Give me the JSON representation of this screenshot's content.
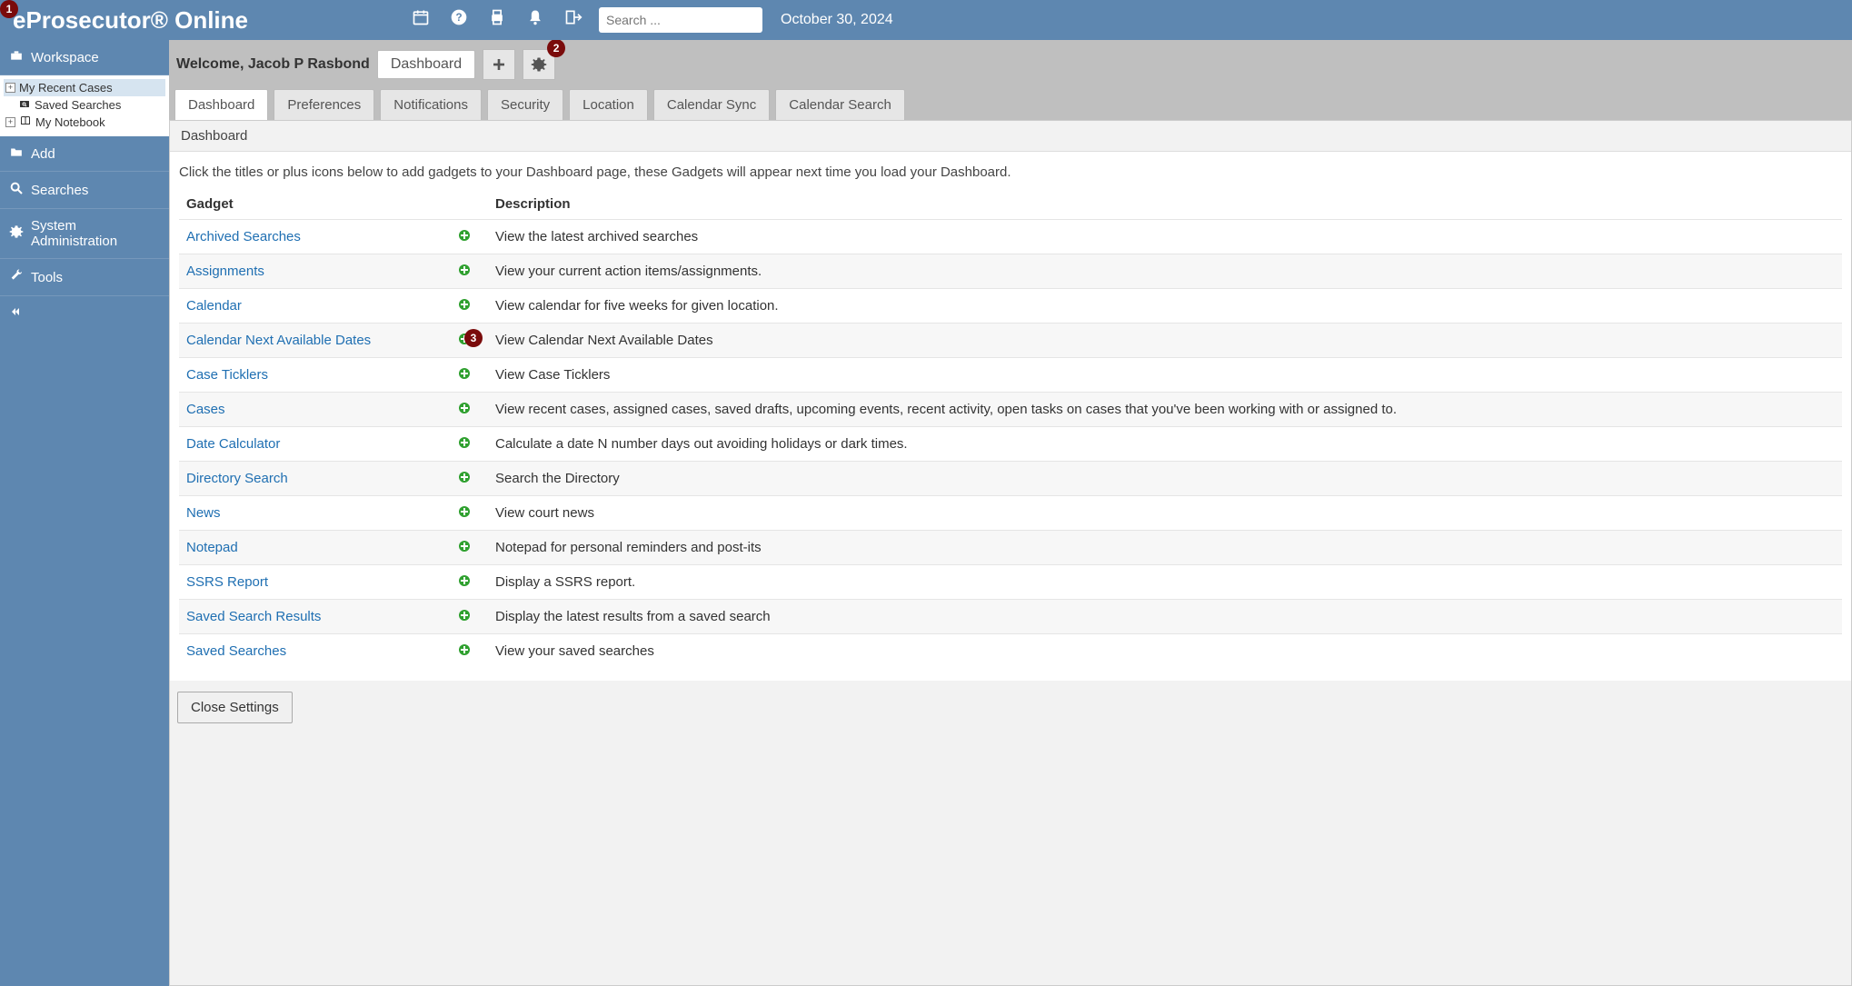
{
  "app_title": "eProsecutor® Online",
  "header": {
    "search_placeholder": "Search ...",
    "date": "October 30, 2024"
  },
  "sidebar": {
    "workspace_label": "Workspace",
    "tree": {
      "recent_cases": "My Recent Cases",
      "saved_searches": "Saved Searches",
      "my_notebook": "My Notebook"
    },
    "add_label": "Add",
    "searches_label": "Searches",
    "sysadmin_label": "System Administration",
    "tools_label": "Tools"
  },
  "welcome": "Welcome, Jacob P Rasbond",
  "dash_tab": "Dashboard",
  "settings_tabs": {
    "dashboard": "Dashboard",
    "preferences": "Preferences",
    "notifications": "Notifications",
    "security": "Security",
    "location": "Location",
    "calendar_sync": "Calendar Sync",
    "calendar_search": "Calendar Search"
  },
  "panel_header": "Dashboard",
  "intro": "Click the titles or plus icons below to add gadgets to your Dashboard page, these Gadgets will appear next time you load your Dashboard.",
  "columns": {
    "gadget": "Gadget",
    "description": "Description"
  },
  "gadgets": [
    {
      "name": "Archived Searches",
      "desc": "View the latest archived searches"
    },
    {
      "name": "Assignments",
      "desc": "View your current action items/assignments."
    },
    {
      "name": "Calendar",
      "desc": "View calendar for five weeks for given location."
    },
    {
      "name": "Calendar Next Available Dates",
      "desc": "View Calendar Next Available Dates"
    },
    {
      "name": "Case Ticklers",
      "desc": "View Case Ticklers"
    },
    {
      "name": "Cases",
      "desc": "View recent cases, assigned cases, saved drafts, upcoming events, recent activity, open tasks on cases that you've been working with or assigned to."
    },
    {
      "name": "Date Calculator",
      "desc": "Calculate a date N number days out avoiding holidays or dark times."
    },
    {
      "name": "Directory Search",
      "desc": "Search the Directory"
    },
    {
      "name": "News",
      "desc": "View court news"
    },
    {
      "name": "Notepad",
      "desc": "Notepad for personal reminders and post-its"
    },
    {
      "name": "SSRS Report",
      "desc": "Display a SSRS report."
    },
    {
      "name": "Saved Search Results",
      "desc": "Display the latest results from a saved search"
    },
    {
      "name": "Saved Searches",
      "desc": "View your saved searches"
    }
  ],
  "close_settings": "Close Settings",
  "annotations": {
    "a1": "1",
    "a2": "2",
    "a3": "3"
  }
}
